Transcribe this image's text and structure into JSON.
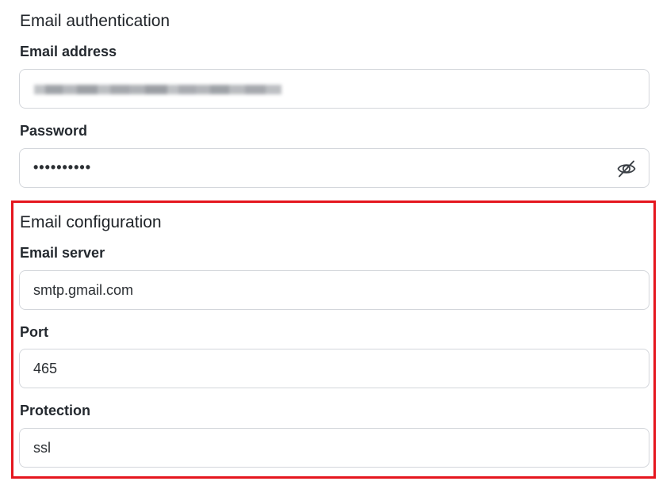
{
  "auth_section": {
    "title": "Email authentication",
    "email_label": "Email address",
    "email_value": "",
    "password_label": "Password",
    "password_value": "••••••••••"
  },
  "config_section": {
    "title": "Email configuration",
    "server_label": "Email server",
    "server_value": "smtp.gmail.com",
    "port_label": "Port",
    "port_value": "465",
    "protection_label": "Protection",
    "protection_value": "ssl"
  },
  "icons": {
    "password_toggle": "eye-slash-icon"
  },
  "colors": {
    "highlight_border": "#e5161e",
    "input_border": "#d3d6db",
    "text": "#1f2328"
  }
}
